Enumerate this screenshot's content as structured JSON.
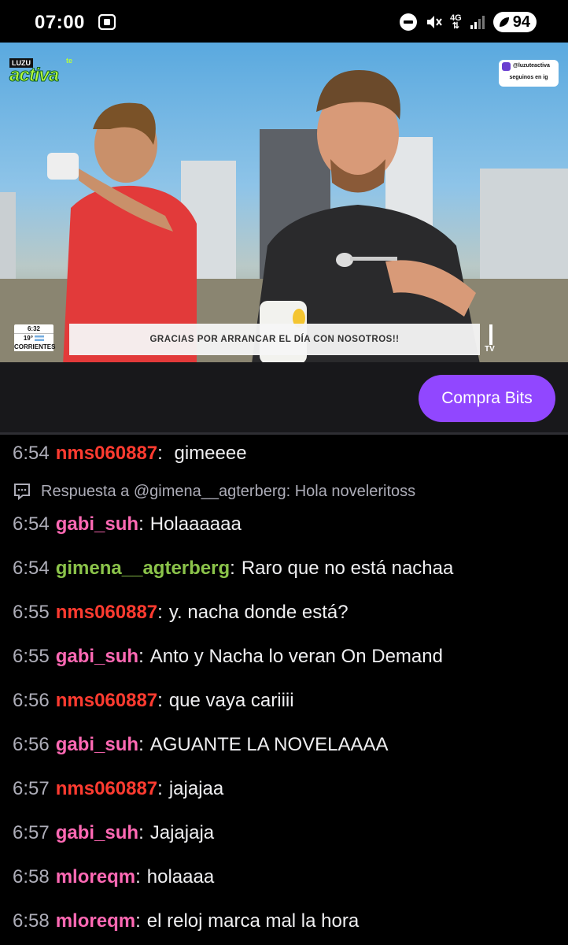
{
  "status_bar": {
    "time": "07:00",
    "network": "4G",
    "battery": "94"
  },
  "video": {
    "logo_top": "LUZU",
    "logo_te": "te",
    "logo_main": "activa",
    "ig_handle": "@luzuteactiva",
    "ig_sub": "seguinos en ig",
    "clock_time": "6:32",
    "clock_temp": "19°",
    "clock_location": "CORRIENTES",
    "banner_text": "GRACIAS POR ARRANCAR EL DÍA CON NOSOTROS!!",
    "tv_mark": "TV"
  },
  "buy_bits_label": "Compra Bits",
  "chat": {
    "partial_message": {
      "time": "6:54",
      "user": "nms060887",
      "text": "gimeeee",
      "color": "#ff3b30"
    },
    "reply_label": "Respuesta a @gimena__agterberg: Hola noveleritoss",
    "messages": [
      {
        "time": "6:54",
        "user": "gabi_suh",
        "text": "Holaaaaaa",
        "color": "#ff69b4"
      },
      {
        "time": "6:54",
        "user": "gimena__agterberg",
        "text": "Raro que no está nachaa",
        "color": "#8bc34a"
      },
      {
        "time": "6:55",
        "user": "nms060887",
        "text": "y. nacha donde está?",
        "color": "#ff3b30"
      },
      {
        "time": "6:55",
        "user": "gabi_suh",
        "text": "Anto y Nacha lo veran On Demand",
        "color": "#ff69b4"
      },
      {
        "time": "6:56",
        "user": "nms060887",
        "text": "que vaya cariiii",
        "color": "#ff3b30"
      },
      {
        "time": "6:56",
        "user": "gabi_suh",
        "text": "AGUANTE LA NOVELAAAA",
        "color": "#ff69b4"
      },
      {
        "time": "6:57",
        "user": "nms060887",
        "text": "jajajaa",
        "color": "#ff3b30"
      },
      {
        "time": "6:57",
        "user": "gabi_suh",
        "text": "Jajajaja",
        "color": "#ff69b4"
      },
      {
        "time": "6:58",
        "user": "mloreqm",
        "text": "holaaaa",
        "color": "#ff69b4"
      },
      {
        "time": "6:58",
        "user": "mloreqm",
        "text": "el reloj marca mal la hora",
        "color": "#ff69b4"
      }
    ]
  },
  "colors": {
    "accent": "#9147ff",
    "panel": "#18181b"
  }
}
